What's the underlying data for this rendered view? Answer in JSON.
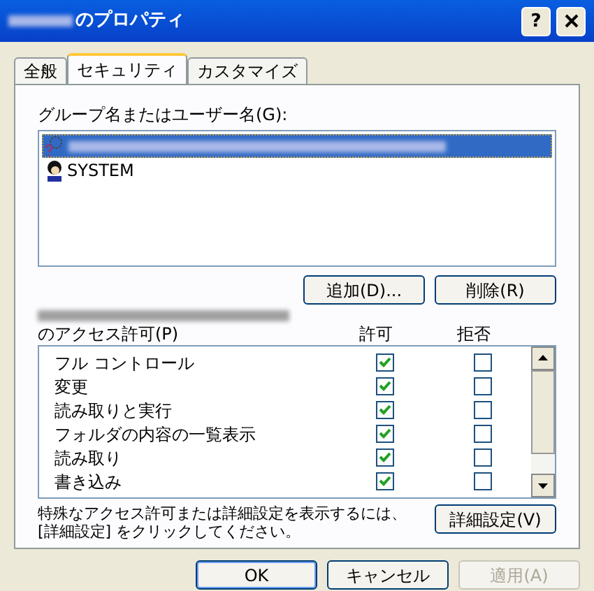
{
  "window": {
    "title": "のプロパティ",
    "buttons": [
      {
        "kind": "help",
        "label": "?"
      },
      {
        "kind": "close"
      }
    ]
  },
  "tabs": [
    {
      "label": "全般",
      "selected": false
    },
    {
      "label": "セキュリティ",
      "selected": true
    },
    {
      "label": "カスタマイズ",
      "selected": false
    }
  ],
  "users": {
    "label": "グループ名またはユーザー名(G):",
    "items": [
      {
        "kind": "unknown",
        "selected": true
      },
      {
        "kind": "system",
        "name": "SYSTEM",
        "selected": false
      }
    ],
    "buttons": [
      {
        "label": "追加(D)..."
      },
      {
        "label": "削除(R)"
      }
    ]
  },
  "permissions": {
    "label": "のアクセス許可(P)",
    "columns": [
      "許可",
      "拒否"
    ],
    "rows": [
      {
        "name": "フル コントロール",
        "allow": true,
        "deny": false
      },
      {
        "name": "変更",
        "allow": true,
        "deny": false
      },
      {
        "name": "読み取りと実行",
        "allow": true,
        "deny": false
      },
      {
        "name": "フォルダの内容の一覧表示",
        "allow": true,
        "deny": false
      },
      {
        "name": "読み取り",
        "allow": true,
        "deny": false
      },
      {
        "name": "書き込み",
        "allow": true,
        "deny": false
      }
    ]
  },
  "advanced": {
    "text": "特殊なアクセス許可または詳細設定を表示するには、[詳細設定] をクリックしてください。",
    "button": "詳細設定(V)"
  },
  "footer": [
    {
      "label": "OK",
      "disabled": false,
      "default": true
    },
    {
      "label": "キャンセル",
      "disabled": false,
      "default": false
    },
    {
      "label": "適用(A)",
      "disabled": true,
      "default": false
    }
  ]
}
